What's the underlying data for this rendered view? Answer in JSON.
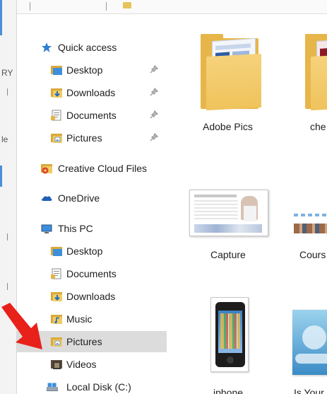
{
  "background_window": {
    "fragments": [
      "RY",
      "le"
    ]
  },
  "nav": {
    "quick_access": {
      "label": "Quick access",
      "items": [
        {
          "label": "Desktop",
          "pinned": true
        },
        {
          "label": "Downloads",
          "pinned": true
        },
        {
          "label": "Documents",
          "pinned": true
        },
        {
          "label": "Pictures",
          "pinned": true
        }
      ]
    },
    "creative_cloud": {
      "label": "Creative Cloud Files"
    },
    "onedrive": {
      "label": "OneDrive"
    },
    "this_pc": {
      "label": "This PC",
      "items": [
        {
          "label": "Desktop"
        },
        {
          "label": "Documents"
        },
        {
          "label": "Downloads"
        },
        {
          "label": "Music"
        },
        {
          "label": "Pictures",
          "selected": true
        },
        {
          "label": "Videos"
        },
        {
          "label": "Local Disk (C:)"
        }
      ]
    }
  },
  "content": {
    "tiles": [
      {
        "label": "Adobe Pics",
        "kind": "folder-with-preview"
      },
      {
        "label": "che",
        "kind": "folder-with-preview"
      },
      {
        "label": "Capture",
        "kind": "image"
      },
      {
        "label": "Cours",
        "kind": "image"
      },
      {
        "label": "iphone",
        "kind": "image"
      },
      {
        "label": "Is Your",
        "kind": "image"
      }
    ]
  },
  "colors": {
    "selection": "#dcdcdc",
    "folder": "#f2cc62",
    "quick_access_star": "#2f7fd1",
    "onedrive": "#1f5fb8",
    "creative_cloud": "#d9452b",
    "annotation_arrow": "#e8211b"
  }
}
